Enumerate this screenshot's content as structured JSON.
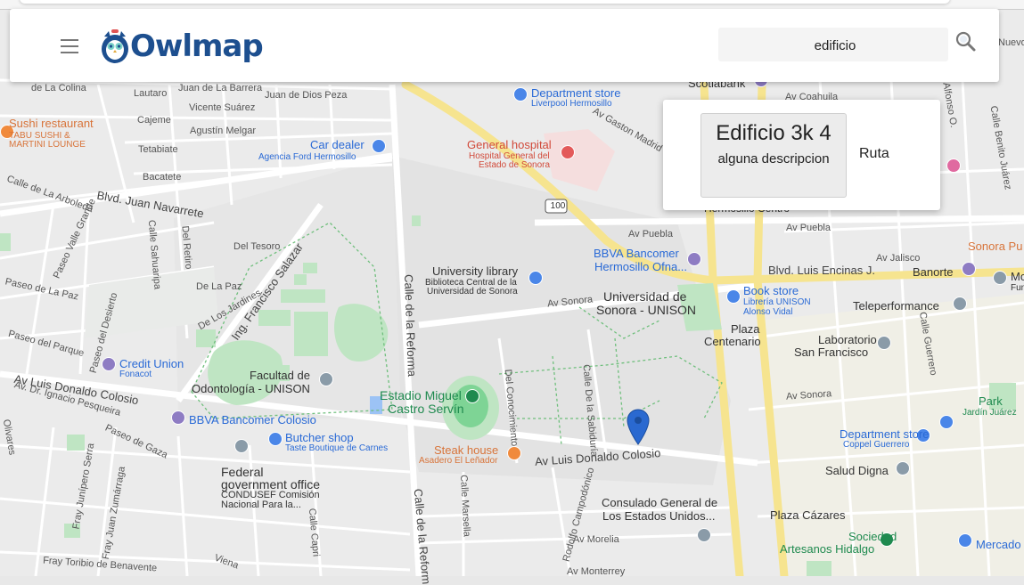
{
  "app": {
    "logo_text": "Owlmap",
    "menu_icon": "hamburger-icon",
    "search_icon": "magnifier-icon"
  },
  "search": {
    "value": "edificio",
    "placeholder": ""
  },
  "popup": {
    "result_title": "Edificio 3k 4",
    "result_description": "alguna descripcion",
    "route_label": "Ruta"
  },
  "map": {
    "roads": {
      "laColina": "de La Colina",
      "lautaro": "Lautaro",
      "juanBarrera": "Juan de La Barrera",
      "juanDiosPeza": "Juan de Dios Peza",
      "cajeme": "Cajeme",
      "vicenteSuarez": "Vicente Suárez",
      "agustinMelgar": "Agustín Melgar",
      "tetabiate": "Tetabiate",
      "bacatete": "Bacatete",
      "arboleda": "Calle de La Arboleda",
      "blvdNavarrete": "Blvd. Juan Navarrete",
      "vallegrande": "Paseo Valle Grande",
      "sahuaripa": "Calle Sahuaripa",
      "delRetiro": "Del Retiro",
      "delTesoro": "Del Tesoro",
      "paseoPaz": "Paseo de La Paz",
      "delaPaz": "De La Paz",
      "jardines": "De Los Jardines",
      "ingSalazar": "Ing. Francisco Salazar",
      "paseoParque": "Paseo del Parque",
      "desierto": "Paseo del Desierto",
      "reforma": "Calle de la Reforma",
      "reforma2": "Calle de la Reform",
      "avColosioW": "Av Luis Donaldo Colosio",
      "avColosioE": "Av Luis Donaldo Colosio",
      "pesqueira": "Av. Dr. Ignacio Pesqueira",
      "olivares": "Olivares",
      "paseoGaza": "Paseo de Gaza",
      "serra": "Fray Junípero Serra",
      "zumarraga": "Fray Juan Zumárraga",
      "benavente": "Fray Toribio de Benavente",
      "viena": "Viena",
      "capri": "Calle Capri",
      "marsella": "Calle Marsella",
      "campodonico": "Rodolfo Campodónico",
      "morelia": "Av Morelia",
      "monterrey": "Av Monterrey",
      "conocimiento": "Del Conocimiento",
      "sabiduria": "Calle De la Sabiduría",
      "avSonoraW": "Av Sonora",
      "avSonoraE": "Av Sonora",
      "avPuebla": "Av Puebla",
      "avPuebla2": "Av Puebla",
      "avJalisco": "Av Jalisco",
      "blvdEncinas": "Blvd. Luis Encinas J.",
      "gastonMadrid": "Av Gaston Madrid",
      "coahuila": "Av Coahuila",
      "benitoJuarez": "Calle Benito Juárez",
      "alfonsoOrtiz": "Alfonso O.",
      "guerrero": "Calle Guerrero",
      "nuevo": "Nuevo",
      "hwy": "100"
    },
    "pois": {
      "sushi": "Sushi restaurant",
      "sushiSub": "TABU SUSHI &",
      "sushiSub2": "MARTINI LOUNGE",
      "carDealer": "Car dealer",
      "carDealerSub": "Agencia Ford Hermosillo",
      "deptStore": "Department store",
      "deptStoreSub": "Liverpool Hermosillo",
      "scotiabank": "Scotiabank",
      "hospital": "General hospital",
      "hospitalSub": "Hospital General del",
      "hospitalSub2": "Estado de Sonora",
      "library": "University library",
      "librarySub": "Biblioteca Central de la",
      "librarySub2": "Universidad de Sonora",
      "bbvaHmo": "BBVA Bancomer",
      "bbvaHmoSub": "Hermosillo Ofna...",
      "unison": "Universidad de",
      "unison2": "Sonora - UNISON",
      "bookstore": "Book store",
      "bookstoreSub": "Librería UNISON",
      "bookstoreSub2": "Alonso Vidal",
      "plazaCentenario": "Plaza",
      "plazaCentenario2": "Centenario",
      "teleperformance": "Teleperformance",
      "banorte": "Banorte",
      "sonoraPu": "Sonora Pu",
      "laboratorio": "Laboratorio",
      "laboratorio2": "San Francisco",
      "creditUnion": "Credit Union",
      "creditUnionSub": "Fonacot",
      "facultad": "Facultad de",
      "facultad2": "Odontología - UNISON",
      "estadio": "Estadio Miguel",
      "estadio2": "Castro Servín",
      "bbvaColosio": "BBVA Bancomer Colosio",
      "butcher": "Butcher shop",
      "butcherSub": "Taste Boutique de Carnes",
      "steak": "Steak house",
      "steakSub": "Asadero El Leñador",
      "federal": "Federal",
      "federal2": "government office",
      "federalSub": "CONDUSEF Comisión",
      "federalSub2": "Nacional Para la...",
      "consulado": "Consulado General de",
      "consulado2": "Los Estados Unidos...",
      "plazaCazares": "Plaza Cázares",
      "sociedad": "Sociedad",
      "sociedad2": "Artesanos Hidalgo",
      "mercado": "Mercado",
      "deptCoppel": "Department store",
      "deptCoppelSub": "Coppel Guerrero",
      "saludDigna": "Salud Digna",
      "park": "Park",
      "parkSub": "Jardín Juárez",
      "hermosilloCentro": "Hermosillo Centro",
      "moFu": "Mo",
      "moFu2": "Fun"
    }
  }
}
